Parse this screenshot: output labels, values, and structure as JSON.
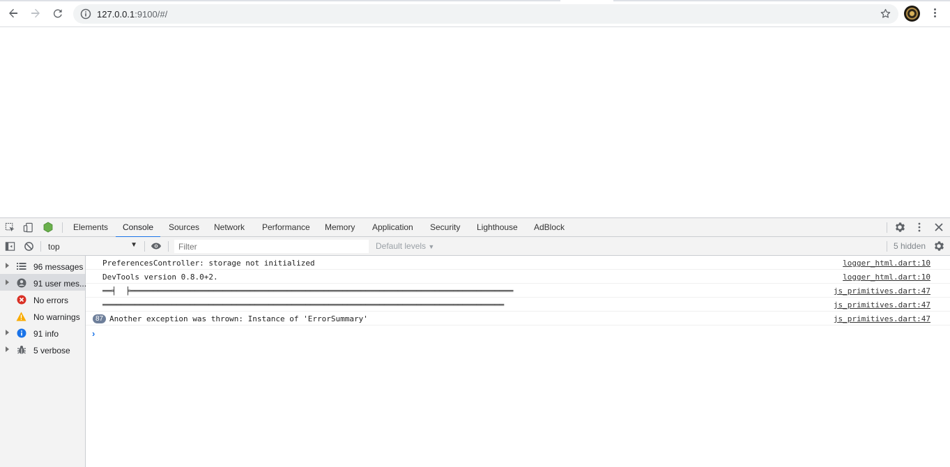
{
  "browser": {
    "url_host": "127.0.0.1",
    "url_rest": ":9100/#/"
  },
  "devtools": {
    "tabs": [
      "Elements",
      "Console",
      "Sources",
      "Network",
      "Performance",
      "Memory",
      "Application",
      "Security",
      "Lighthouse",
      "AdBlock"
    ],
    "active_tab": "Console",
    "toolbar": {
      "context": "top",
      "filter_placeholder": "Filter",
      "levels": "Default levels",
      "hidden": "5 hidden"
    },
    "sidebar": [
      {
        "label": "96 messages",
        "icon": "list-icon"
      },
      {
        "label": "91 user mes...",
        "icon": "user-icon"
      },
      {
        "label": "No errors",
        "icon": "error-icon"
      },
      {
        "label": "No warnings",
        "icon": "warning-icon"
      },
      {
        "label": "91 info",
        "icon": "info-icon"
      },
      {
        "label": "5 verbose",
        "icon": "bug-icon"
      }
    ],
    "messages": [
      {
        "text": "PreferencesController: storage not initialized",
        "source": "logger_html.dart:10"
      },
      {
        "text": "DevTools version 0.8.0+2.",
        "source": "logger_html.dart:10"
      },
      {
        "text": "══╡  ╞═══════════════════════════════════════════════════════════════════════════════════",
        "source": "js_primitives.dart:47"
      },
      {
        "text": "═══════════════════════════════════════════════════════════════════════════════════════",
        "source": "js_primitives.dart:47"
      },
      {
        "text": "Another exception was thrown: Instance of 'ErrorSummary'",
        "source": "js_primitives.dart:47",
        "count": "87"
      }
    ]
  },
  "colors": {
    "accent": "#1a73e8",
    "error": "#d93025",
    "warning": "#f9ab00",
    "info": "#1a73e8",
    "node": "#6ab04c"
  }
}
